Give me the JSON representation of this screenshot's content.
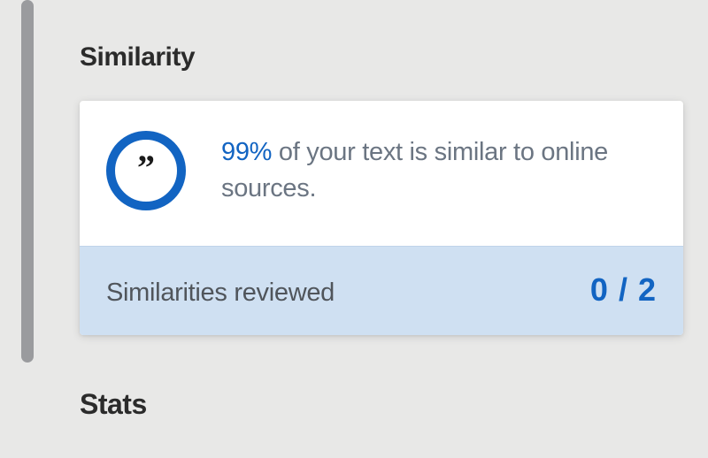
{
  "sections": {
    "similarity": {
      "title": "Similarity",
      "summary": {
        "percent": "99%",
        "rest": " of your text is similar to online sources."
      },
      "reviewed": {
        "label": "Similarities reviewed",
        "current": "0",
        "separator": " / ",
        "total": "2"
      }
    },
    "stats": {
      "title": "Stats"
    }
  },
  "icons": {
    "quote": "”"
  },
  "colors": {
    "accent": "#1264c2",
    "panel_blue": "#cfe0f2",
    "bg": "#e8e8e7"
  }
}
